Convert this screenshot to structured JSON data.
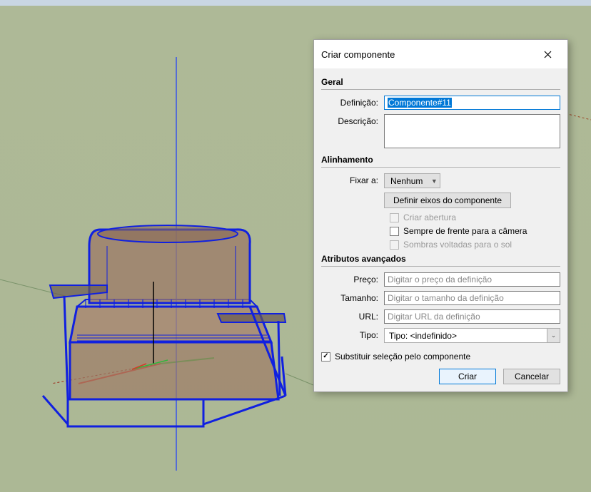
{
  "dialog": {
    "title": "Criar componente",
    "sections": {
      "general": {
        "header": "Geral",
        "definition_label": "Definição:",
        "definition_value": "Componente#11",
        "description_label": "Descrição:",
        "description_value": ""
      },
      "alignment": {
        "header": "Alinhamento",
        "glue_label": "Fixar a:",
        "glue_option": "Nenhum",
        "set_axes_button": "Definir eixos do componente",
        "cut_opening_label": "Criar abertura",
        "always_face_label": "Sempre de frente para a câmera",
        "shadows_label": "Sombras voltadas para o sol"
      },
      "advanced": {
        "header": "Atributos avançados",
        "price_label": "Preço:",
        "price_placeholder": "Digitar o preço da definição",
        "size_label": "Tamanho:",
        "size_placeholder": "Digitar o tamanho da definição",
        "url_label": "URL:",
        "url_placeholder": "Digitar URL da definição",
        "type_label": "Tipo:",
        "type_value": "Tipo: <indefinido>"
      }
    },
    "replace_selection_label": "Substituir seleção pelo componente",
    "create_button": "Criar",
    "cancel_button": "Cancelar"
  }
}
